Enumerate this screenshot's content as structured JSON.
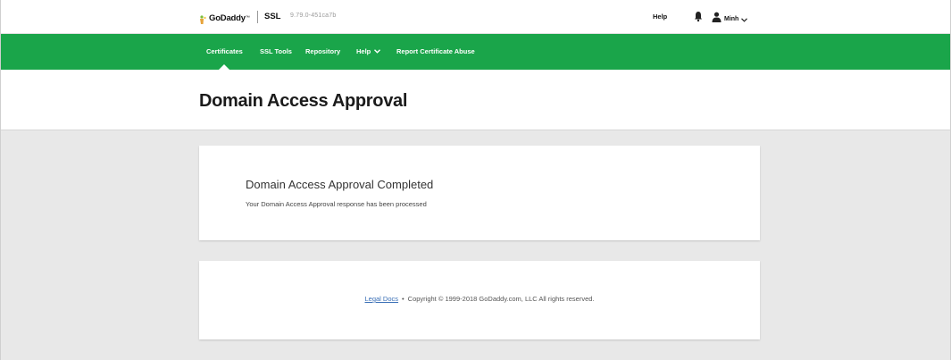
{
  "header": {
    "brand": "GoDaddy",
    "brand_tm": "™",
    "product": "SSL",
    "version": "9.79.0-451ca7b",
    "help_label": "Help",
    "user_name": "Minh",
    "icons": {
      "bell": "bell-icon",
      "user": "user-icon",
      "chevron": "chevron-down-icon"
    }
  },
  "nav": {
    "items": [
      {
        "label": "Certificates",
        "active": true
      },
      {
        "label": "SSL Tools"
      },
      {
        "label": "Repository"
      },
      {
        "label": "Help",
        "has_dropdown": true
      },
      {
        "label": "Report Certificate Abuse"
      }
    ]
  },
  "page": {
    "title": "Domain Access Approval"
  },
  "status_card": {
    "heading": "Domain Access Approval Completed",
    "message": "Your Domain Access Approval response has been processed"
  },
  "footer": {
    "legal_link": "Legal Docs",
    "separator": "•",
    "copyright": "Copyright © 1999-2018 GoDaddy.com, LLC All rights reserved."
  },
  "colors": {
    "brand_green": "#1aa54a",
    "page_background": "#e8e8e8",
    "link_blue": "#3a6fb6"
  }
}
